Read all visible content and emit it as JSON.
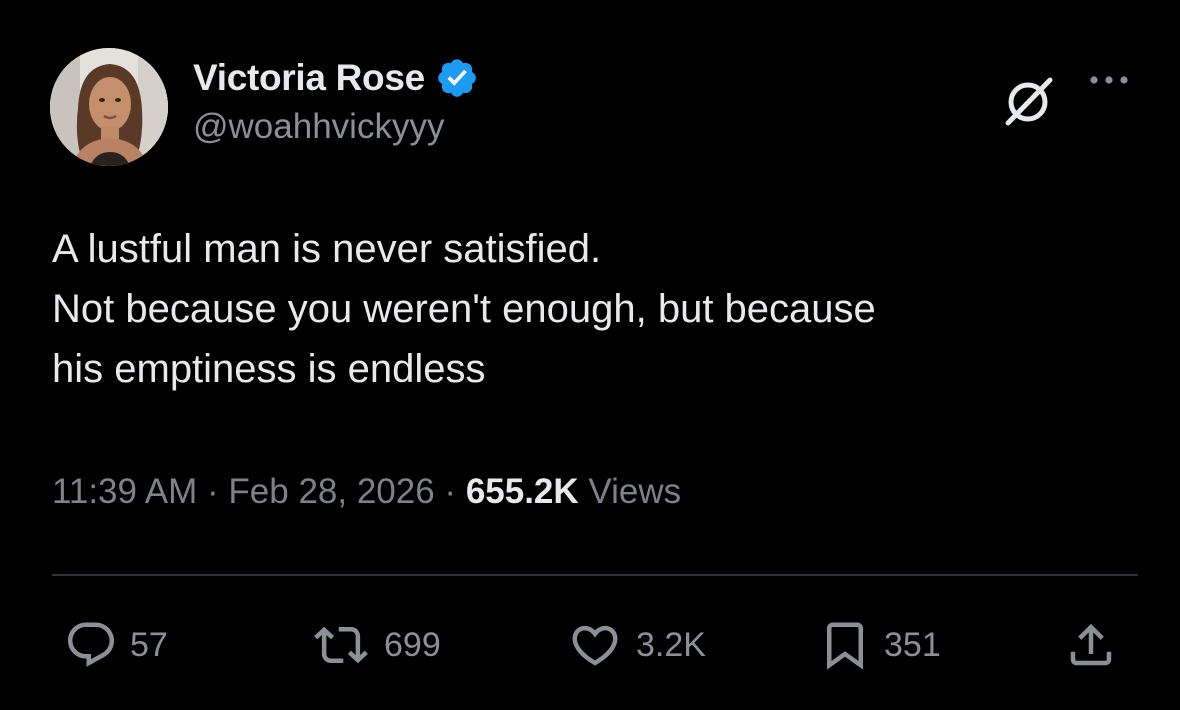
{
  "author": {
    "display_name": "Victoria Rose",
    "handle": "@woahhvickyyy",
    "verified": true,
    "verified_color": "#1d9bf0"
  },
  "tweet": {
    "lines": [
      "A lustful man is never satisfied.",
      "Not because you weren't enough, but because",
      "his emptiness is endless"
    ],
    "time": "11:39 AM",
    "separator": "·",
    "date": "Feb 28, 2026",
    "views_count": "655.2K",
    "views_label": "Views"
  },
  "actions": {
    "replies": "57",
    "retweets": "699",
    "likes": "3.2K",
    "bookmarks": "351"
  },
  "icons": {
    "verified": "verified-badge-icon",
    "grok": "grok-icon",
    "more": "more-dots-icon",
    "reply": "reply-bubble-icon",
    "retweet": "retweet-icon",
    "like": "heart-icon",
    "bookmark": "bookmark-icon",
    "share": "share-icon"
  },
  "colors": {
    "background": "#000000",
    "text_primary": "#e7e9ea",
    "text_secondary": "#8b9096",
    "divider": "#2f3336",
    "accent": "#1d9bf0"
  }
}
